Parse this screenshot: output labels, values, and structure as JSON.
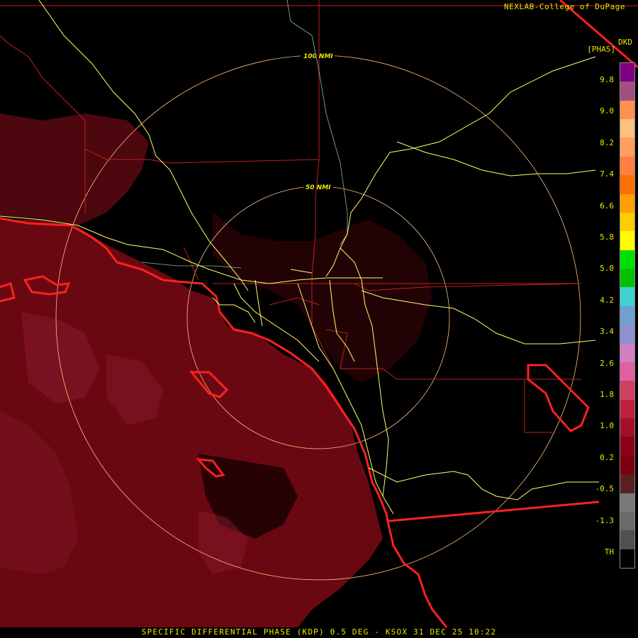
{
  "credit": "NEXLAB-College of DuPage",
  "product_code": "DKD",
  "units": "[PHAS]",
  "caption": "SPECIFIC DIFFERENTIAL PHASE (KDP) 0.5 DEG - KSOX 31 DEC 25 10:22",
  "rings": [
    "100 NMI",
    "50 NMI"
  ],
  "scale_ticks": [
    "9.8",
    "9.0",
    "8.2",
    "7.4",
    "6.6",
    "5.8",
    "5.0",
    "4.2",
    "3.4",
    "2.6",
    "1.8",
    "1.0",
    "0.2",
    "-0.5",
    "-1.3",
    "TH"
  ],
  "scale_colors": [
    "#000000",
    "#505050",
    "#6a6a6a",
    "#7a7a7a",
    "#5a2020",
    "#7a0010",
    "#8a0018",
    "#a0102a",
    "#c02040",
    "#d04060",
    "#e060a0",
    "#d080c0",
    "#9090d0",
    "#70a0d0",
    "#40d0d0",
    "#00c000",
    "#00e000",
    "#ffff00",
    "#ffcc00",
    "#ffa000",
    "#ff7000",
    "#ff8040",
    "#ffa060",
    "#ffc080",
    "#ff9050",
    "#a05080",
    "#800080"
  ],
  "colors": {
    "echo": "#6e0a14",
    "echo_light": "#8a1a2e",
    "coast": "#ff2020",
    "road": "#ffff66",
    "border": "#c02020",
    "ring": "#ffc080",
    "river": "#80c0a0",
    "text": "#e8e800"
  }
}
